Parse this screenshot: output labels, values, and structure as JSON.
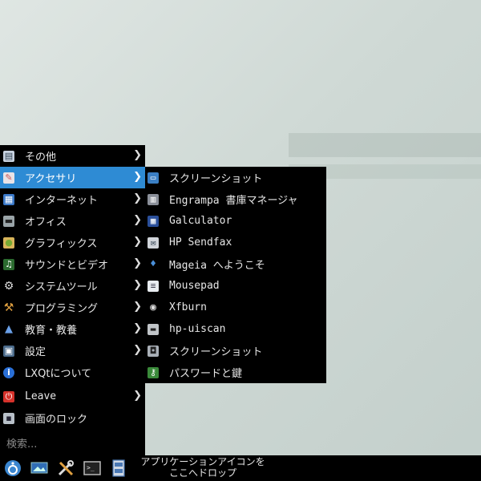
{
  "main_menu": {
    "items": [
      {
        "label": "その他",
        "icon": "folder-icon",
        "submenu": true
      },
      {
        "label": "アクセサリ",
        "icon": "accessories-icon",
        "submenu": true,
        "active": true
      },
      {
        "label": "インターネット",
        "icon": "internet-icon",
        "submenu": true
      },
      {
        "label": "オフィス",
        "icon": "office-icon",
        "submenu": true
      },
      {
        "label": "グラフィックス",
        "icon": "graphics-icon",
        "submenu": true
      },
      {
        "label": "サウンドとビデオ",
        "icon": "sound-video-icon",
        "submenu": true
      },
      {
        "label": "システムツール",
        "icon": "gear-icon",
        "submenu": true
      },
      {
        "label": "プログラミング",
        "icon": "hammer-icon",
        "submenu": true
      },
      {
        "label": "教育・教養",
        "icon": "flask-icon",
        "submenu": true
      },
      {
        "label": "設定",
        "icon": "settings-icon",
        "submenu": true
      },
      {
        "label": "LXQtについて",
        "icon": "info-icon",
        "submenu": false
      },
      {
        "label": "Leave",
        "icon": "power-icon",
        "submenu": true
      },
      {
        "label": "画面のロック",
        "icon": "lock-icon",
        "submenu": false
      }
    ],
    "chevron": "❯",
    "search_placeholder": "検索..."
  },
  "submenu": {
    "items": [
      {
        "label": "スクリーンショット",
        "icon": "screenshot-icon"
      },
      {
        "label": "Engrampa 書庫マネージャ",
        "icon": "archive-icon"
      },
      {
        "label": "Galculator",
        "icon": "calculator-icon"
      },
      {
        "label": "HP Sendfax",
        "icon": "fax-icon"
      },
      {
        "label": "Mageia へようこそ",
        "icon": "mageia-icon"
      },
      {
        "label": "Mousepad",
        "icon": "text-editor-icon"
      },
      {
        "label": "Xfburn",
        "icon": "disc-icon"
      },
      {
        "label": "hp-uiscan",
        "icon": "scanner-icon"
      },
      {
        "label": "スクリーンショット",
        "icon": "screenshot-camera-icon"
      },
      {
        "label": "パスワードと鍵",
        "icon": "keys-icon"
      }
    ]
  },
  "taskbar": {
    "buttons": [
      "start-menu-icon",
      "show-desktop-icon",
      "tools-icon",
      "terminal-icon",
      "file-manager-icon"
    ],
    "drop_hint_line1": "アプリケーションアイコンを",
    "drop_hint_line2": "ここへドロップ"
  },
  "colors": {
    "accent": "#2e8bd4",
    "menu_bg": "#000000"
  }
}
